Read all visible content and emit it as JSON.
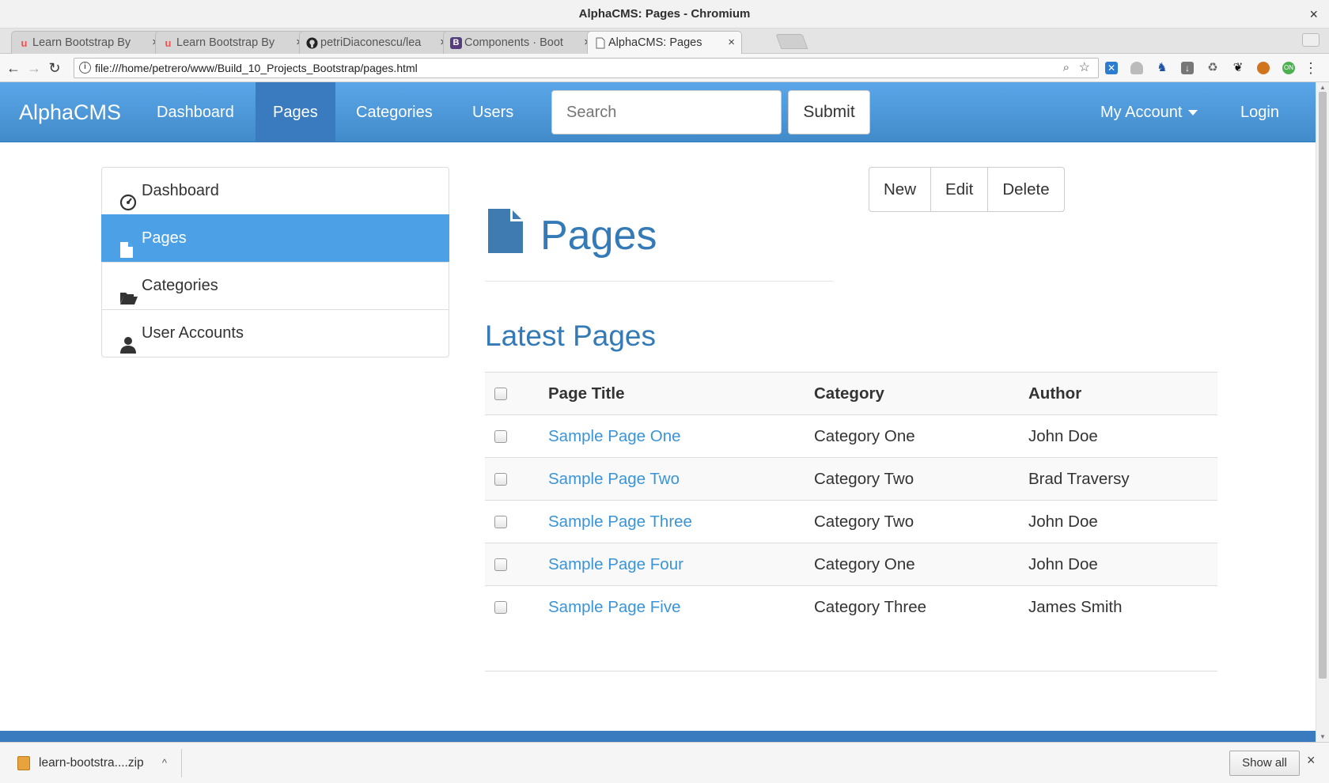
{
  "window": {
    "title": "AlphaCMS: Pages - Chromium",
    "close_glyph": "×"
  },
  "tabs": [
    {
      "label": "Learn Bootstrap By",
      "icon": "udemy-icon",
      "close": "×"
    },
    {
      "label": "Learn Bootstrap By",
      "icon": "udemy-icon",
      "close": "×"
    },
    {
      "label": "petriDiaconescu/lea",
      "icon": "github-icon",
      "close": "×"
    },
    {
      "label": "Components · Boot",
      "icon": "bootstrap-icon",
      "close": "×"
    },
    {
      "label": "AlphaCMS: Pages",
      "icon": "page-icon",
      "close": "×",
      "active": true
    }
  ],
  "address_bar": {
    "url": "file:///home/petrero/www/Build_10_Projects_Bootstrap/pages.html"
  },
  "navbar": {
    "brand": "AlphaCMS",
    "links": [
      "Dashboard",
      "Pages",
      "Categories",
      "Users"
    ],
    "active_link": "Pages",
    "search_placeholder": "Search",
    "submit_label": "Submit",
    "account_label": "My Account",
    "login_label": "Login",
    "color": "#428bca"
  },
  "sidebar": {
    "items": [
      {
        "label": "Dashboard",
        "icon": "dashboard-icon"
      },
      {
        "label": "Pages",
        "icon": "file-icon",
        "active": true
      },
      {
        "label": "Categories",
        "icon": "folder-open-icon"
      },
      {
        "label": "User Accounts",
        "icon": "user-icon"
      }
    ]
  },
  "actions": {
    "new": "New",
    "edit": "Edit",
    "delete": "Delete"
  },
  "header": {
    "title": "Pages",
    "icon": "file-icon"
  },
  "latest": {
    "title": "Latest Pages",
    "columns": [
      "Page Title",
      "Category",
      "Author"
    ],
    "rows": [
      {
        "title": "Sample Page One",
        "category": "Category One",
        "author": "John Doe"
      },
      {
        "title": "Sample Page Two",
        "category": "Category Two",
        "author": "Brad Traversy"
      },
      {
        "title": "Sample Page Three",
        "category": "Category Two",
        "author": "John Doe"
      },
      {
        "title": "Sample Page Four",
        "category": "Category One",
        "author": "John Doe"
      },
      {
        "title": "Sample Page Five",
        "category": "Category Three",
        "author": "James Smith"
      }
    ]
  },
  "downloads": {
    "file": "learn-bootstra....zip",
    "show_all": "Show all",
    "close_glyph": "×"
  },
  "colors": {
    "accent": "#337ab7",
    "active_item": "#4ca1e6",
    "link": "#3a94d6"
  }
}
